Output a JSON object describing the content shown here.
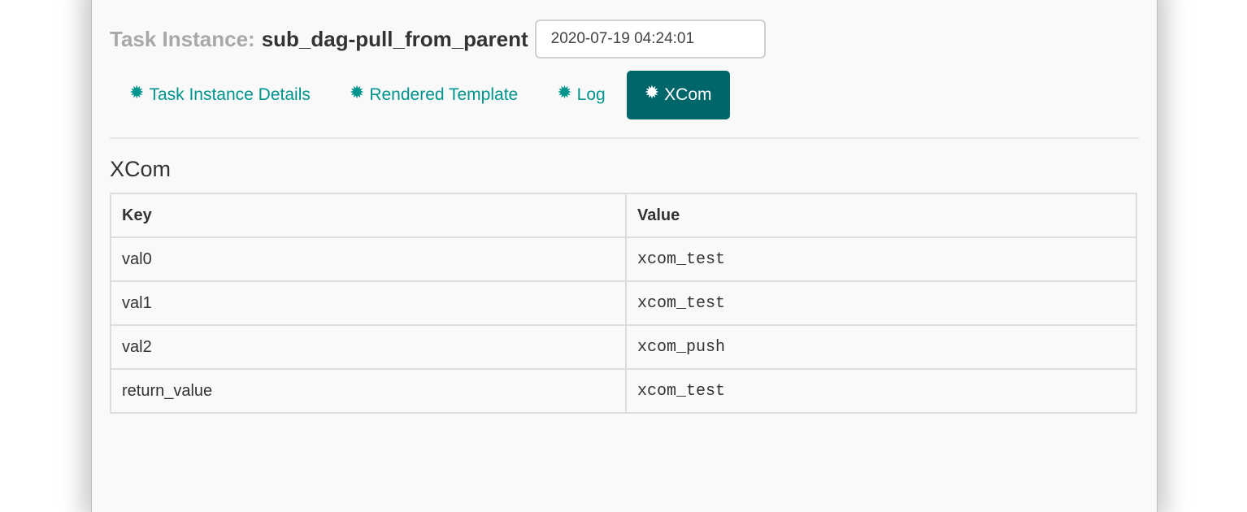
{
  "header": {
    "label": "Task Instance:",
    "task_name": "sub_dag-pull_from_parent",
    "execution_date": "2020-07-19 04:24:01"
  },
  "tabs": [
    {
      "label": "Task Instance Details",
      "icon": "gear-icon",
      "active": false
    },
    {
      "label": "Rendered Template",
      "icon": "gear-icon",
      "active": false
    },
    {
      "label": "Log",
      "icon": "gear-icon",
      "active": false
    },
    {
      "label": "XCom",
      "icon": "gear-icon",
      "active": true
    }
  ],
  "section": {
    "title": "XCom"
  },
  "table": {
    "columns": [
      "Key",
      "Value"
    ],
    "rows": [
      {
        "key": "val0",
        "value": "xcom_test"
      },
      {
        "key": "val1",
        "value": "xcom_test"
      },
      {
        "key": "val2",
        "value": "xcom_push"
      },
      {
        "key": "return_value",
        "value": "xcom_test"
      }
    ]
  },
  "colors": {
    "accent": "#00948d",
    "active_tab_bg": "#00666a",
    "muted_label": "#a8a8a8"
  }
}
